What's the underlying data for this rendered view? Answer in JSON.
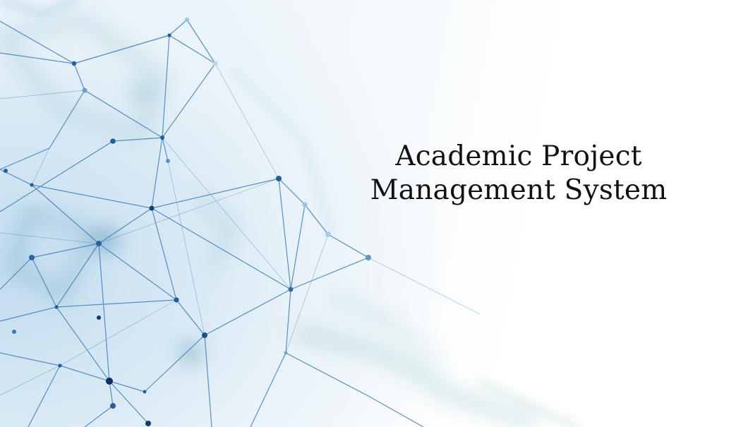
{
  "slide": {
    "title_line_1": "Academic Project",
    "title_line_2": "Management System"
  },
  "colors": {
    "background": "#ffffff",
    "network_line": "#3a78b4",
    "network_node": "#1f5fa0",
    "network_haze": "#7fb6c9",
    "title_text": "#111111"
  },
  "icons": {
    "background_art": "network-graph-icon"
  }
}
